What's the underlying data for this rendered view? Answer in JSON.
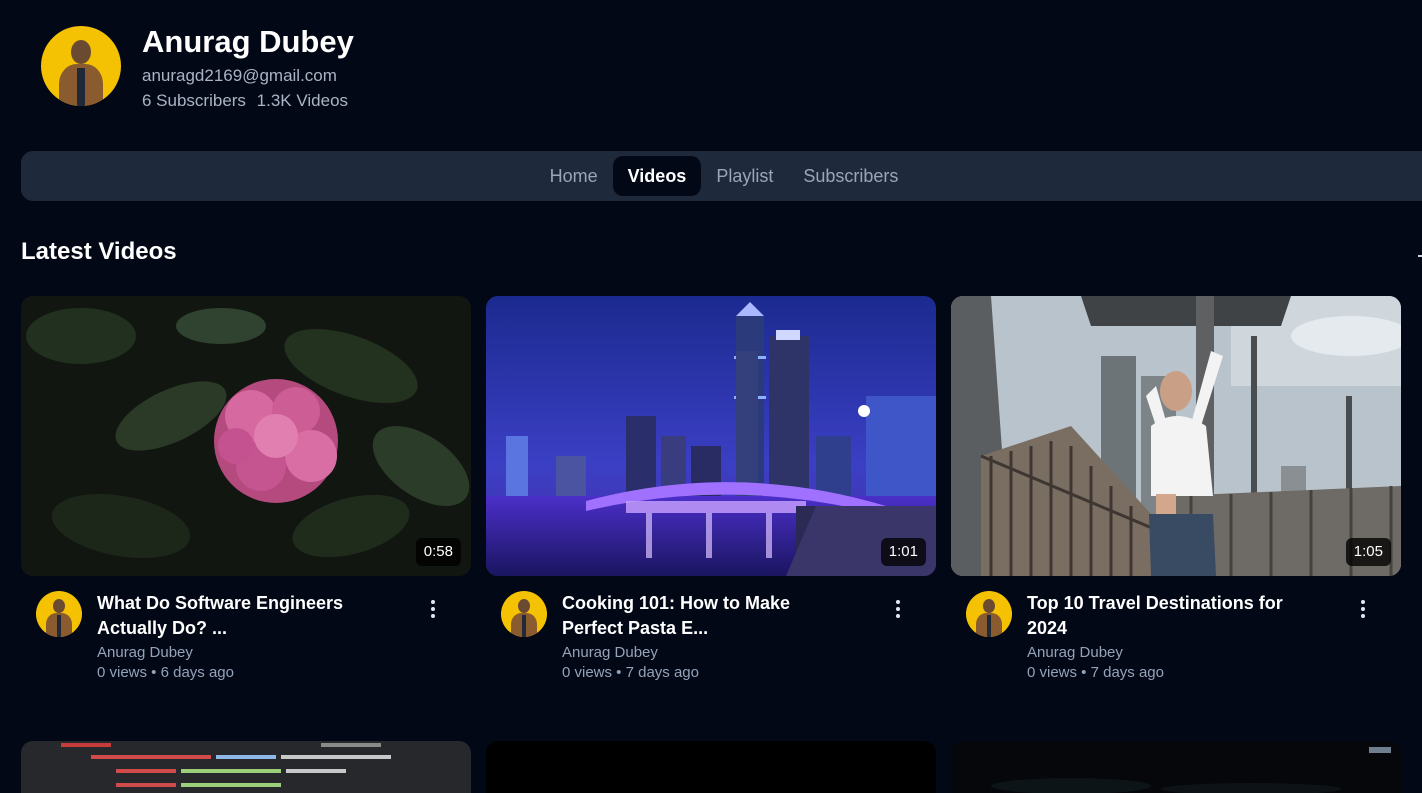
{
  "channel": {
    "name": "Anurag Dubey",
    "email": "anuragd2169@gmail.com",
    "subscribers": "6 Subscribers",
    "videos": "1.3K Videos"
  },
  "tabs": [
    {
      "label": "Home",
      "active": false
    },
    {
      "label": "Videos",
      "active": true
    },
    {
      "label": "Playlist",
      "active": false
    },
    {
      "label": "Subscribers",
      "active": false
    }
  ],
  "section": {
    "title": "Latest Videos"
  },
  "videos": [
    {
      "title": "What Do Software Engineers Actually Do? ...",
      "channel": "Anurag Dubey",
      "stats": "0 views • 6 days ago",
      "duration": "0:58",
      "thumb": "flower-icon"
    },
    {
      "title": "Cooking 101: How to Make Perfect Pasta E...",
      "channel": "Anurag Dubey",
      "stats": "0 views • 7 days ago",
      "duration": "1:01",
      "thumb": "city-night-icon"
    },
    {
      "title": "Top 10 Travel Destinations for 2024",
      "channel": "Anurag Dubey",
      "stats": "0 views • 7 days ago",
      "duration": "1:05",
      "thumb": "urban-portrait-icon"
    }
  ],
  "colors": {
    "background": "#030817",
    "tabs_bar": "#1e293b",
    "avatar_bg": "#f5c203",
    "muted_text": "#94a3b8"
  }
}
